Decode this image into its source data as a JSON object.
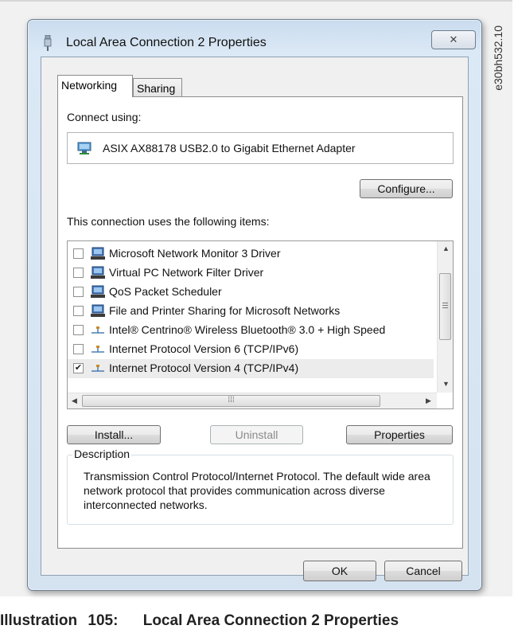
{
  "doc_code": "e30bh532.10",
  "caption": {
    "label": "Illustration",
    "number": "105:",
    "title": "Local Area Connection 2 Properties"
  },
  "window": {
    "title": "Local Area Connection 2 Properties",
    "close_glyph": "✕",
    "tabs": [
      "Networking",
      "Sharing"
    ],
    "active_tab": "Networking"
  },
  "networking": {
    "connect_using_label": "Connect using:",
    "adapter_name": "ASIX AX88178 USB2.0 to Gigabit Ethernet Adapter",
    "configure_label": "Configure...",
    "items_label": "This connection uses the following items:",
    "items": [
      {
        "label": "Microsoft Network Monitor 3 Driver",
        "checked": false,
        "icon": "network-client-icon"
      },
      {
        "label": "Virtual PC Network Filter Driver",
        "checked": false,
        "icon": "network-client-icon"
      },
      {
        "label": "QoS Packet Scheduler",
        "checked": false,
        "icon": "network-client-icon"
      },
      {
        "label": "File and Printer Sharing for Microsoft Networks",
        "checked": false,
        "icon": "network-client-icon"
      },
      {
        "label": "Intel® Centrino® Wireless Bluetooth® 3.0 + High Speed",
        "checked": false,
        "icon": "protocol-icon"
      },
      {
        "label": "Internet Protocol Version 6 (TCP/IPv6)",
        "checked": false,
        "icon": "protocol-icon"
      },
      {
        "label": "Internet Protocol Version 4 (TCP/IPv4)",
        "checked": true,
        "icon": "protocol-icon"
      }
    ],
    "install_label": "Install...",
    "uninstall_label": "Uninstall",
    "properties_label": "Properties",
    "description_legend": "Description",
    "description_text": "Transmission Control Protocol/Internet Protocol. The default wide area network protocol that provides communication across diverse interconnected networks."
  },
  "footer": {
    "ok_label": "OK",
    "cancel_label": "Cancel"
  }
}
